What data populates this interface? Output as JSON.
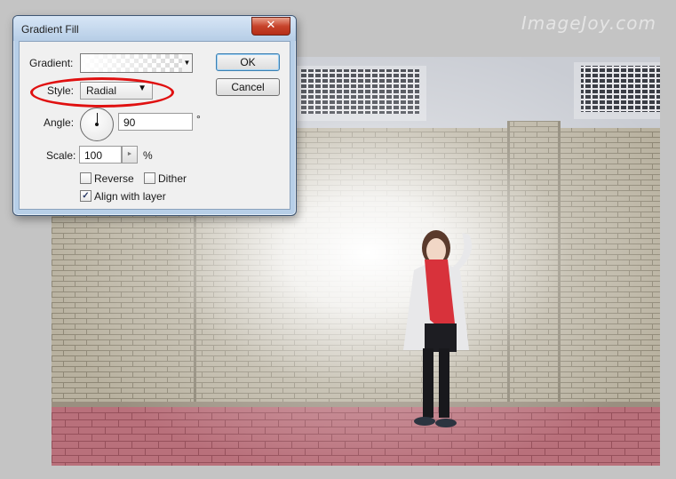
{
  "watermark": "ImageJoy.com",
  "dialog": {
    "title": "Gradient Fill",
    "close_glyph": "✕",
    "gradient_label": "Gradient:",
    "style_label": "Style:",
    "style_value": "Radial",
    "angle_label": "Angle:",
    "angle_value": "90",
    "angle_unit": "°",
    "scale_label": "Scale:",
    "scale_value": "100",
    "scale_unit": "%",
    "reverse_label": "Reverse",
    "reverse_checked": false,
    "dither_label": "Dither",
    "dither_checked": false,
    "align_label": "Align with layer",
    "align_checked": true,
    "ok_label": "OK",
    "cancel_label": "Cancel",
    "check_glyph": "✓",
    "highlight_color": "#e01010"
  }
}
